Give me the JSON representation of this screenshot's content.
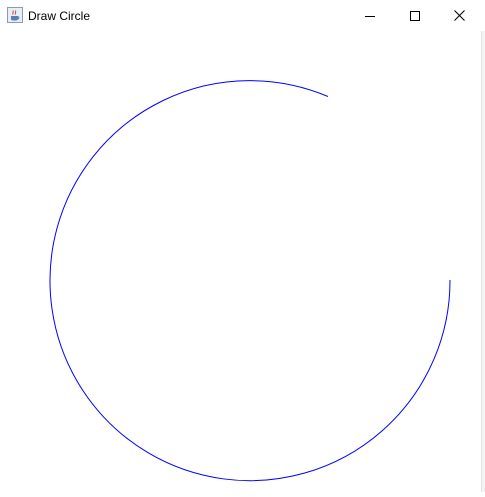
{
  "window": {
    "title": "Draw Circle",
    "icon": "java-cup-icon",
    "controls": {
      "minimize_icon": "minimize-icon",
      "maximize_icon": "maximize-icon",
      "close_icon": "close-icon"
    }
  },
  "drawing": {
    "shape": "circle-arc",
    "stroke_color": "#0000ff",
    "background_color": "#ffffff"
  }
}
